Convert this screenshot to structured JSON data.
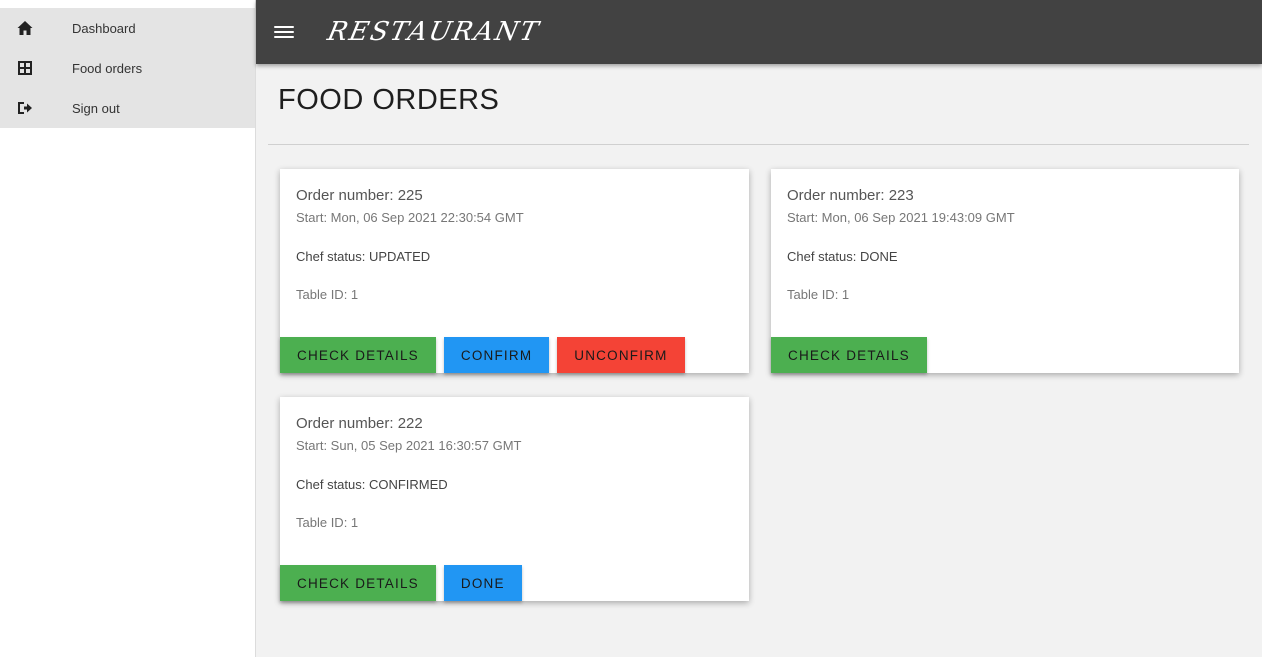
{
  "sidebar": {
    "items": [
      {
        "label": "Dashboard",
        "icon": "home-icon"
      },
      {
        "label": "Food orders",
        "icon": "grid-icon"
      },
      {
        "label": "Sign out",
        "icon": "sign-out-icon"
      }
    ]
  },
  "topbar": {
    "brand": "RESTAURANT"
  },
  "page": {
    "title": "FOOD ORDERS"
  },
  "orders": [
    {
      "order_number": "Order number: 225",
      "start": "Start: Mon, 06 Sep 2021 22:30:54 GMT",
      "chef_status": "Chef status: UPDATED",
      "table_id": "Table ID: 1",
      "buttons": [
        "CHECK DETAILS",
        "CONFIRM",
        "UNCONFIRM"
      ]
    },
    {
      "order_number": "Order number: 223",
      "start": "Start: Mon, 06 Sep 2021 19:43:09 GMT",
      "chef_status": "Chef status: DONE",
      "table_id": "Table ID: 1",
      "buttons": [
        "CHECK DETAILS"
      ]
    },
    {
      "order_number": "Order number: 222",
      "start": "Start: Sun, 05 Sep 2021 16:30:57 GMT",
      "chef_status": "Chef status: CONFIRMED",
      "table_id": "Table ID: 1",
      "buttons": [
        "CHECK DETAILS",
        "DONE"
      ]
    }
  ],
  "colors": {
    "topbar": "#424242",
    "green": "#4caf50",
    "blue": "#2196f3",
    "red": "#f44336"
  }
}
